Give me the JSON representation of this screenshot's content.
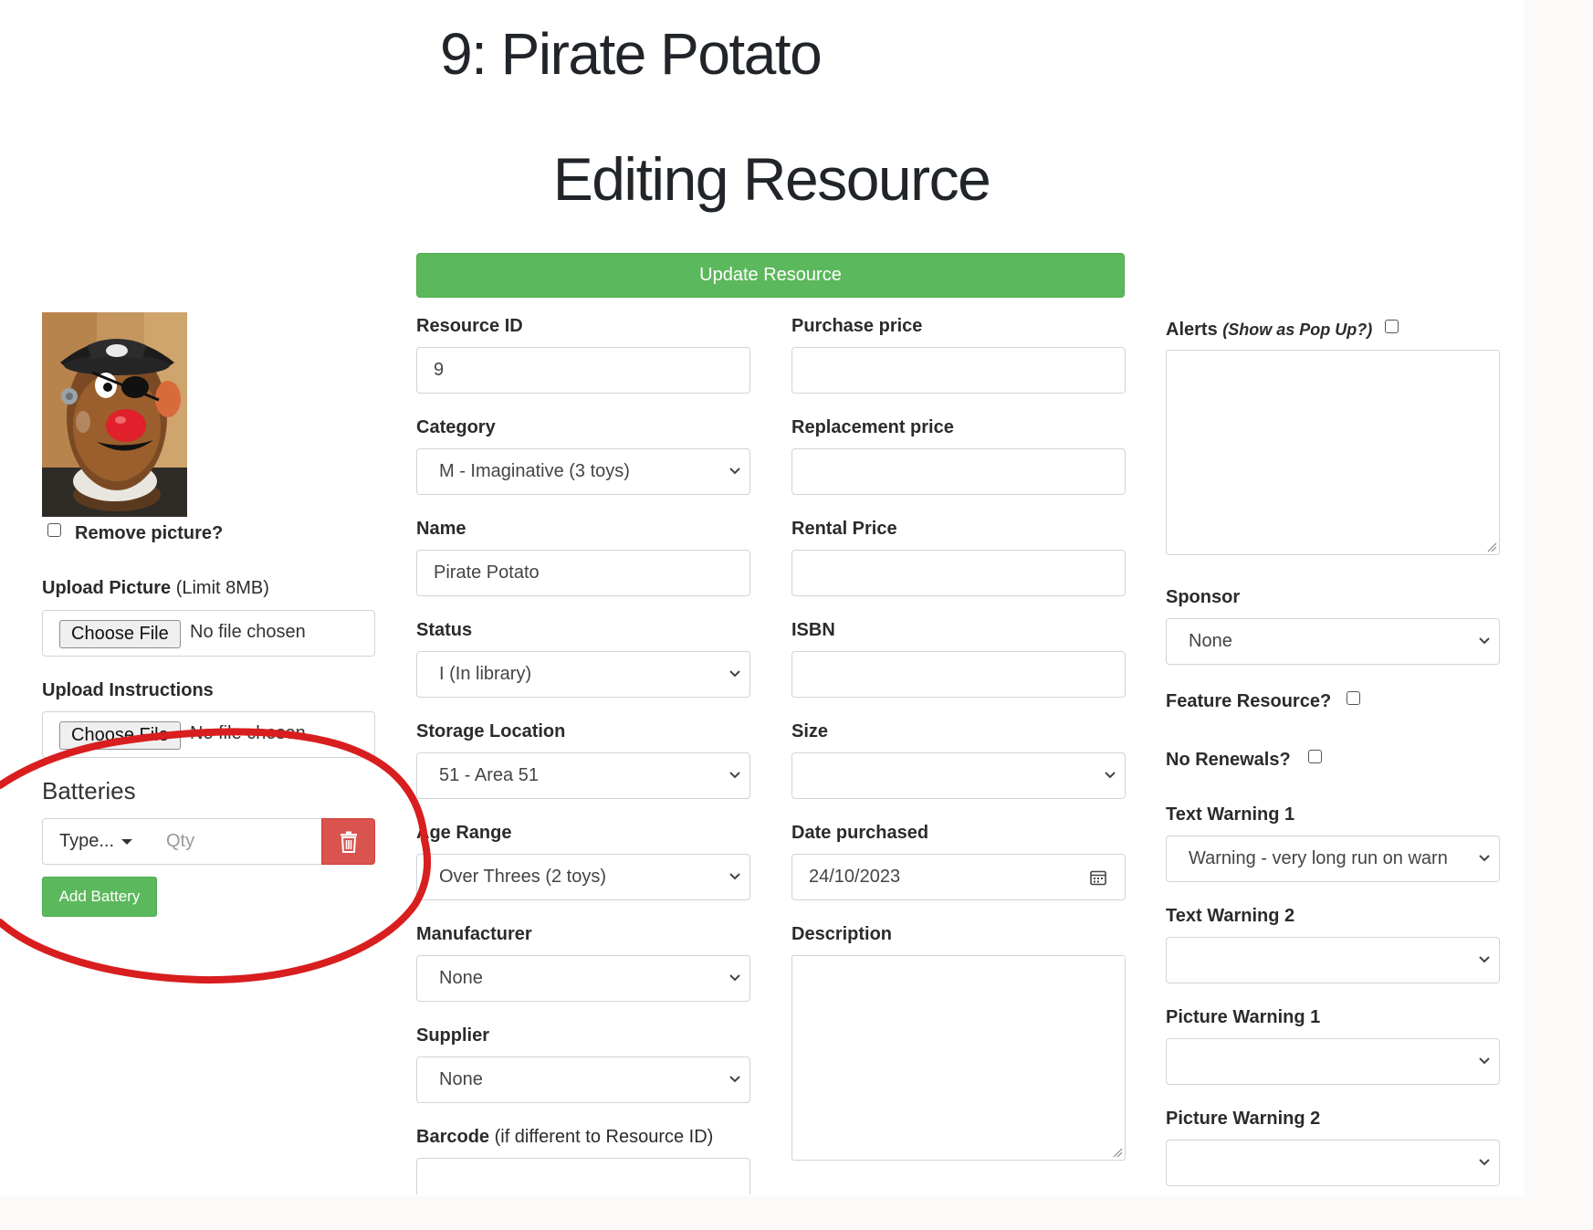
{
  "resource_title": "9: Pirate Potato",
  "page_heading": "Editing Resource",
  "update_button": "Update Resource",
  "left": {
    "remove_picture_label": "Remove picture?",
    "upload_picture_label": "Upload Picture",
    "upload_picture_limit": "(Limit 8MB)",
    "upload_instructions_label": "Upload Instructions",
    "choose_file": "Choose File",
    "no_file": "No file chosen",
    "batteries_title": "Batteries",
    "battery_type": "Type...",
    "battery_qty_placeholder": "Qty",
    "add_battery": "Add Battery"
  },
  "col1": {
    "resource_id": {
      "label": "Resource ID",
      "value": "9"
    },
    "category": {
      "label": "Category",
      "value": "M - Imaginative (3 toys)"
    },
    "name": {
      "label": "Name",
      "value": "Pirate Potato"
    },
    "status": {
      "label": "Status",
      "value": "I (In library)"
    },
    "storage_location": {
      "label": "Storage Location",
      "value": "51 - Area 51"
    },
    "age_range": {
      "label": "Age Range",
      "value": "Over Threes (2 toys)"
    },
    "manufacturer": {
      "label": "Manufacturer",
      "value": "None"
    },
    "supplier": {
      "label": "Supplier",
      "value": "None"
    },
    "barcode": {
      "label": "Barcode",
      "hint": "(if different to Resource ID)",
      "value": ""
    }
  },
  "col2": {
    "purchase_price": {
      "label": "Purchase price",
      "value": ""
    },
    "replacement_price": {
      "label": "Replacement price",
      "value": ""
    },
    "rental_price": {
      "label": "Rental Price",
      "value": ""
    },
    "isbn": {
      "label": "ISBN",
      "value": ""
    },
    "size": {
      "label": "Size",
      "value": ""
    },
    "date_purchased": {
      "label": "Date purchased",
      "value": "24/10/2023"
    },
    "description": {
      "label": "Description",
      "value": ""
    }
  },
  "col3": {
    "alerts_label": "Alerts",
    "alerts_hint": "(Show as Pop Up?)",
    "sponsor": {
      "label": "Sponsor",
      "value": "None"
    },
    "feature_resource_label": "Feature Resource?",
    "no_renewals_label": "No Renewals?",
    "text_warning_1": {
      "label": "Text Warning 1",
      "value": "Warning - very long run on warn"
    },
    "text_warning_2": {
      "label": "Text Warning 2",
      "value": ""
    },
    "picture_warning_1": {
      "label": "Picture Warning 1",
      "value": ""
    },
    "picture_warning_2": {
      "label": "Picture Warning 2",
      "value": ""
    }
  },
  "colors": {
    "primary_green": "#5cb85c",
    "danger_red": "#d9534f",
    "annotation_red": "#d81e1e"
  },
  "icons": [
    "chevron-down-icon",
    "calendar-icon",
    "trash-icon",
    "caret-down-icon",
    "resize-grip-icon"
  ]
}
